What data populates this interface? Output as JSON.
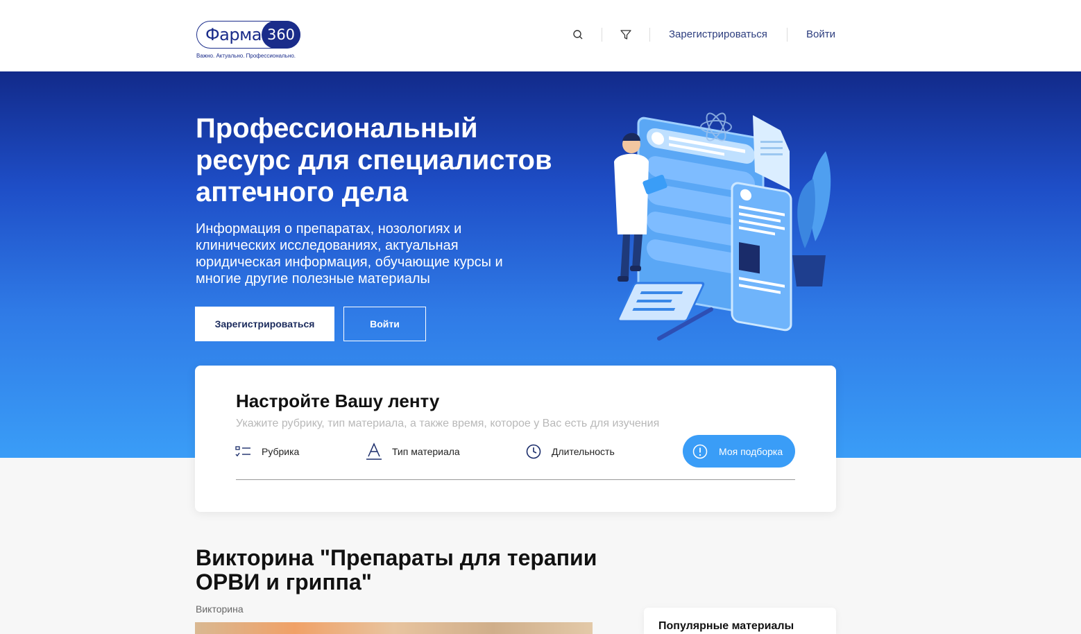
{
  "brand": {
    "name": "Фарма",
    "number": "360",
    "tagline": "Важно. Актуально. Профессионально."
  },
  "nav": {
    "search_icon": "search-icon",
    "filter_icon": "filter-icon",
    "register": "Зарегистрироваться",
    "login": "Войти"
  },
  "hero": {
    "title": "Профессиональный ресурс для специалистов аптечного дела",
    "subtitle": "Информация о препаратах, нозологиях и клинических исследованиях, актуальная юридическая информация, обучающие курсы и многие другие полезные материалы",
    "register_button": "Зарегистрироваться",
    "login_button": "Войти"
  },
  "feed": {
    "title": "Настройте Вашу ленту",
    "subtitle": "Укажите рубрику, тип материала, а также время, которое у Вас есть для изучения",
    "filters": [
      {
        "label": "Рубрика",
        "icon": "list-icon"
      },
      {
        "label": "Тип материала",
        "icon": "letter-a-icon"
      },
      {
        "label": "Длительность",
        "icon": "clock-icon"
      }
    ],
    "my_selection": "Моя подборка"
  },
  "article": {
    "title": "Викторина \"Препараты для терапии ОРВИ и гриппа\"",
    "tag": "Викторина"
  },
  "popular": {
    "title": "Популярные материалы"
  },
  "colors": {
    "brand_blue": "#1a2c8a",
    "accent": "#3a9df7",
    "hero_top": "#122a8a",
    "hero_bottom": "#3a9df7"
  }
}
